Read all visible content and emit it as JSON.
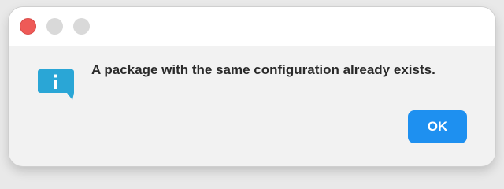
{
  "dialog": {
    "message": "A package with the same configuration already exists.",
    "ok_label": "OK",
    "icon": "info-icon"
  },
  "colors": {
    "accent": "#1e90f0",
    "info_icon": "#2aa6d6",
    "close_button": "#ee5a57"
  }
}
